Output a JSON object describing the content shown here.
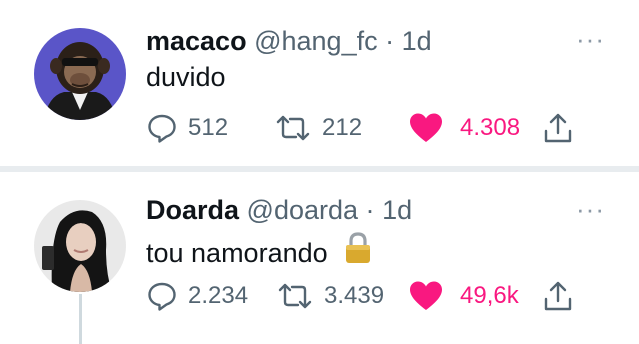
{
  "tweets": [
    {
      "name": "macaco",
      "handle": "@hang_fc",
      "separator": "·",
      "time": "1d",
      "text": "duvido",
      "reply_count": "512",
      "retweet_count": "212",
      "like_count": "4.308",
      "liked": true
    },
    {
      "name": "Doarda",
      "handle": "@doarda",
      "separator": "·",
      "time": "1d",
      "text": "tou namorando",
      "emoji": "lock-icon",
      "reply_count": "2.234",
      "retweet_count": "3.439",
      "like_count": "49,6k",
      "liked": true
    }
  ],
  "more_label": "···",
  "colors": {
    "like": "#f91880",
    "secondary_text": "#536471",
    "primary_text": "#0f1419",
    "divider": "#e8ecef"
  }
}
